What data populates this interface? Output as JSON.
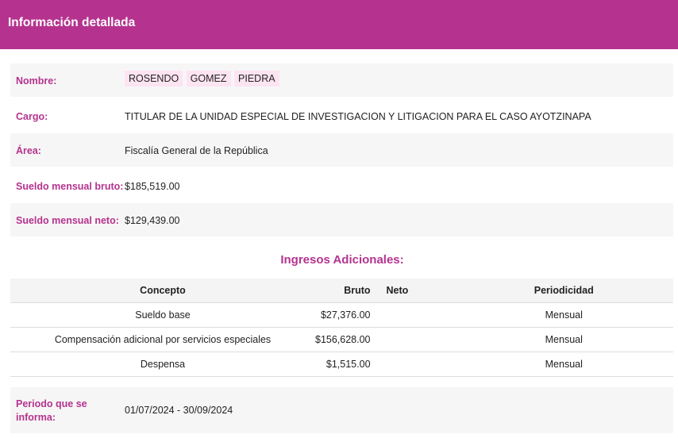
{
  "header": {
    "title": "Información detallada"
  },
  "fields": {
    "nombre": {
      "label": "Nombre:",
      "parts": [
        "ROSENDO",
        "GOMEZ",
        "PIEDRA"
      ]
    },
    "cargo": {
      "label": "Cargo:",
      "value": "TITULAR DE LA UNIDAD ESPECIAL DE INVESTIGACION Y LITIGACION PARA EL CASO AYOTZINAPA"
    },
    "area": {
      "label": "Área:",
      "value": "Fiscalía General de la República"
    },
    "bruto": {
      "label": "Sueldo mensual bruto:",
      "value": "$185,519.00"
    },
    "neto": {
      "label": "Sueldo mensual neto:",
      "value": "$129,439.00"
    },
    "periodo": {
      "label_line1": "Periodo que se",
      "label_line2": "informa:",
      "value": "01/07/2024 - 30/09/2024"
    }
  },
  "ingresos": {
    "title": "Ingresos Adicionales:",
    "headers": {
      "concepto": "Concepto",
      "bruto": "Bruto",
      "neto": "Neto",
      "periodicidad": "Periodicidad"
    },
    "rows": [
      {
        "concepto": "Sueldo base",
        "bruto": "$27,376.00",
        "neto": "",
        "periodicidad": "Mensual"
      },
      {
        "concepto": "Compensación adicional por servicios especiales",
        "bruto": "$156,628.00",
        "neto": "",
        "periodicidad": "Mensual"
      },
      {
        "concepto": "Despensa",
        "bruto": "$1,515.00",
        "neto": "",
        "periodicidad": "Mensual"
      }
    ]
  },
  "colors": {
    "accent": "#b5338f",
    "chip": "#fde4f1",
    "row_shade": "#f6f6f6"
  }
}
